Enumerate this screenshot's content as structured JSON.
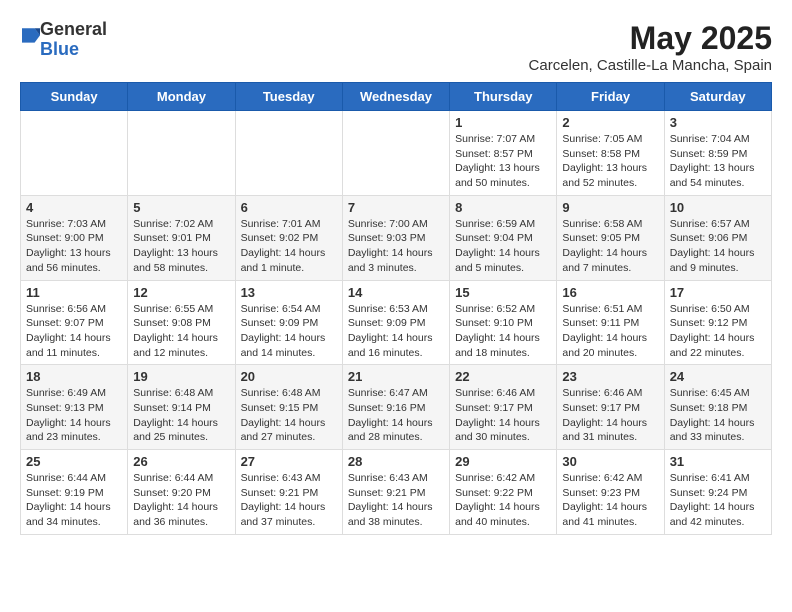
{
  "header": {
    "logo_general": "General",
    "logo_blue": "Blue",
    "month_title": "May 2025",
    "location": "Carcelen, Castille-La Mancha, Spain"
  },
  "days_of_week": [
    "Sunday",
    "Monday",
    "Tuesday",
    "Wednesday",
    "Thursday",
    "Friday",
    "Saturday"
  ],
  "weeks": [
    [
      {
        "day": "",
        "info": ""
      },
      {
        "day": "",
        "info": ""
      },
      {
        "day": "",
        "info": ""
      },
      {
        "day": "",
        "info": ""
      },
      {
        "day": "1",
        "info": "Sunrise: 7:07 AM\nSunset: 8:57 PM\nDaylight: 13 hours\nand 50 minutes."
      },
      {
        "day": "2",
        "info": "Sunrise: 7:05 AM\nSunset: 8:58 PM\nDaylight: 13 hours\nand 52 minutes."
      },
      {
        "day": "3",
        "info": "Sunrise: 7:04 AM\nSunset: 8:59 PM\nDaylight: 13 hours\nand 54 minutes."
      }
    ],
    [
      {
        "day": "4",
        "info": "Sunrise: 7:03 AM\nSunset: 9:00 PM\nDaylight: 13 hours\nand 56 minutes."
      },
      {
        "day": "5",
        "info": "Sunrise: 7:02 AM\nSunset: 9:01 PM\nDaylight: 13 hours\nand 58 minutes."
      },
      {
        "day": "6",
        "info": "Sunrise: 7:01 AM\nSunset: 9:02 PM\nDaylight: 14 hours\nand 1 minute."
      },
      {
        "day": "7",
        "info": "Sunrise: 7:00 AM\nSunset: 9:03 PM\nDaylight: 14 hours\nand 3 minutes."
      },
      {
        "day": "8",
        "info": "Sunrise: 6:59 AM\nSunset: 9:04 PM\nDaylight: 14 hours\nand 5 minutes."
      },
      {
        "day": "9",
        "info": "Sunrise: 6:58 AM\nSunset: 9:05 PM\nDaylight: 14 hours\nand 7 minutes."
      },
      {
        "day": "10",
        "info": "Sunrise: 6:57 AM\nSunset: 9:06 PM\nDaylight: 14 hours\nand 9 minutes."
      }
    ],
    [
      {
        "day": "11",
        "info": "Sunrise: 6:56 AM\nSunset: 9:07 PM\nDaylight: 14 hours\nand 11 minutes."
      },
      {
        "day": "12",
        "info": "Sunrise: 6:55 AM\nSunset: 9:08 PM\nDaylight: 14 hours\nand 12 minutes."
      },
      {
        "day": "13",
        "info": "Sunrise: 6:54 AM\nSunset: 9:09 PM\nDaylight: 14 hours\nand 14 minutes."
      },
      {
        "day": "14",
        "info": "Sunrise: 6:53 AM\nSunset: 9:09 PM\nDaylight: 14 hours\nand 16 minutes."
      },
      {
        "day": "15",
        "info": "Sunrise: 6:52 AM\nSunset: 9:10 PM\nDaylight: 14 hours\nand 18 minutes."
      },
      {
        "day": "16",
        "info": "Sunrise: 6:51 AM\nSunset: 9:11 PM\nDaylight: 14 hours\nand 20 minutes."
      },
      {
        "day": "17",
        "info": "Sunrise: 6:50 AM\nSunset: 9:12 PM\nDaylight: 14 hours\nand 22 minutes."
      }
    ],
    [
      {
        "day": "18",
        "info": "Sunrise: 6:49 AM\nSunset: 9:13 PM\nDaylight: 14 hours\nand 23 minutes."
      },
      {
        "day": "19",
        "info": "Sunrise: 6:48 AM\nSunset: 9:14 PM\nDaylight: 14 hours\nand 25 minutes."
      },
      {
        "day": "20",
        "info": "Sunrise: 6:48 AM\nSunset: 9:15 PM\nDaylight: 14 hours\nand 27 minutes."
      },
      {
        "day": "21",
        "info": "Sunrise: 6:47 AM\nSunset: 9:16 PM\nDaylight: 14 hours\nand 28 minutes."
      },
      {
        "day": "22",
        "info": "Sunrise: 6:46 AM\nSunset: 9:17 PM\nDaylight: 14 hours\nand 30 minutes."
      },
      {
        "day": "23",
        "info": "Sunrise: 6:46 AM\nSunset: 9:17 PM\nDaylight: 14 hours\nand 31 minutes."
      },
      {
        "day": "24",
        "info": "Sunrise: 6:45 AM\nSunset: 9:18 PM\nDaylight: 14 hours\nand 33 minutes."
      }
    ],
    [
      {
        "day": "25",
        "info": "Sunrise: 6:44 AM\nSunset: 9:19 PM\nDaylight: 14 hours\nand 34 minutes."
      },
      {
        "day": "26",
        "info": "Sunrise: 6:44 AM\nSunset: 9:20 PM\nDaylight: 14 hours\nand 36 minutes."
      },
      {
        "day": "27",
        "info": "Sunrise: 6:43 AM\nSunset: 9:21 PM\nDaylight: 14 hours\nand 37 minutes."
      },
      {
        "day": "28",
        "info": "Sunrise: 6:43 AM\nSunset: 9:21 PM\nDaylight: 14 hours\nand 38 minutes."
      },
      {
        "day": "29",
        "info": "Sunrise: 6:42 AM\nSunset: 9:22 PM\nDaylight: 14 hours\nand 40 minutes."
      },
      {
        "day": "30",
        "info": "Sunrise: 6:42 AM\nSunset: 9:23 PM\nDaylight: 14 hours\nand 41 minutes."
      },
      {
        "day": "31",
        "info": "Sunrise: 6:41 AM\nSunset: 9:24 PM\nDaylight: 14 hours\nand 42 minutes."
      }
    ]
  ]
}
